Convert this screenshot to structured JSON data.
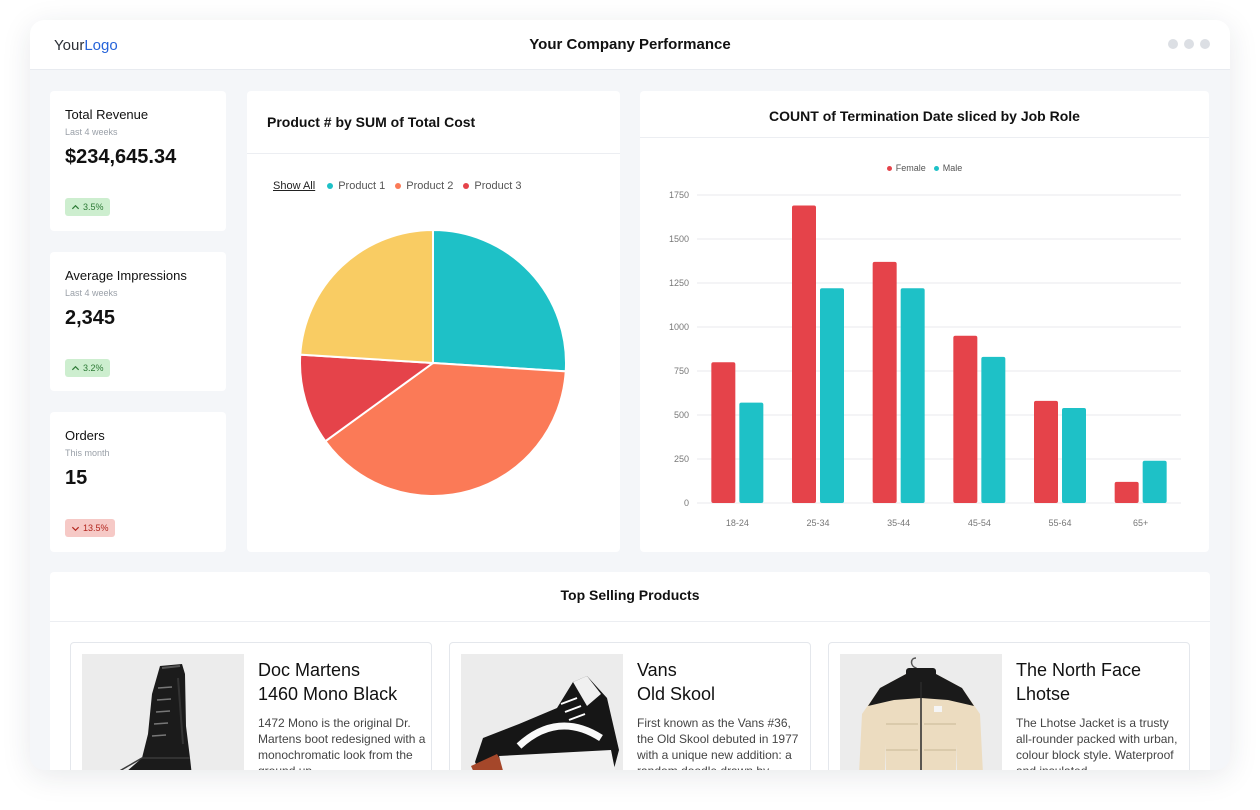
{
  "header": {
    "logo_part1": "Your",
    "logo_part2": "Logo",
    "title": "Your Company Performance"
  },
  "kpis": [
    {
      "title": "Total Revenue",
      "subtitle": "Last 4 weeks",
      "value": "$234,645.34",
      "change": "3.5%",
      "direction": "up"
    },
    {
      "title": "Average Impressions",
      "subtitle": "Last 4 weeks",
      "value": "2,345",
      "change": "3.2%",
      "direction": "up"
    },
    {
      "title": "Orders",
      "subtitle": "This month",
      "value": "15",
      "change": "13.5%",
      "direction": "down"
    }
  ],
  "pie_card": {
    "title": "Product # by SUM of Total Cost",
    "show_all": "Show All"
  },
  "bar_card": {
    "title": "COUNT of Termination Date sliced by Job Role"
  },
  "colors": {
    "teal": "#1ec1c7",
    "orange": "#fb7a57",
    "red": "#e5434a",
    "yellow": "#f9cc63",
    "accent_blue": "#2563d9"
  },
  "chart_data": [
    {
      "type": "pie",
      "title": "Product # by SUM of Total Cost",
      "legend": [
        "Product 1",
        "Product 2",
        "Product 3"
      ],
      "slices": [
        {
          "label": "Product 1",
          "value": 26,
          "color": "#1ec1c7"
        },
        {
          "label": "Product 2",
          "value": 39,
          "color": "#fb7a57"
        },
        {
          "label": "Product 3",
          "value": 11,
          "color": "#e5434a"
        },
        {
          "label": "",
          "value": 24,
          "color": "#f9cc63"
        }
      ]
    },
    {
      "type": "bar",
      "title": "COUNT of Termination Date sliced by Job Role",
      "categories": [
        "18-24",
        "25-34",
        "35-44",
        "45-54",
        "55-64",
        "65+"
      ],
      "series": [
        {
          "name": "Female",
          "color": "#e5434a",
          "values": [
            800,
            1690,
            1370,
            950,
            580,
            120
          ]
        },
        {
          "name": "Male",
          "color": "#1ec1c7",
          "values": [
            570,
            1220,
            1220,
            830,
            540,
            240
          ]
        }
      ],
      "ylim": [
        0,
        1750
      ],
      "yticks": [
        0,
        250,
        500,
        750,
        1000,
        1250,
        1500,
        1750
      ],
      "legend_position": "top-center",
      "grid": true
    }
  ],
  "products_section": {
    "title": "Top Selling Products",
    "items": [
      {
        "name_line1": "Doc Martens",
        "name_line2": "1460 Mono Black",
        "description": "1472 Mono is the original Dr. Martens boot redesigned with a monochromatic look from the ground up."
      },
      {
        "name_line1": "Vans",
        "name_line2": "Old Skool",
        "description": "First known as the Vans #36, the Old Skool debuted in 1977 with a unique new addition: a random doodle drawn by"
      },
      {
        "name_line1": "The North Face",
        "name_line2": "Lhotse",
        "description": "The Lhotse Jacket is a trusty all-rounder packed with urban, colour block style. Waterproof and insulated"
      }
    ]
  }
}
